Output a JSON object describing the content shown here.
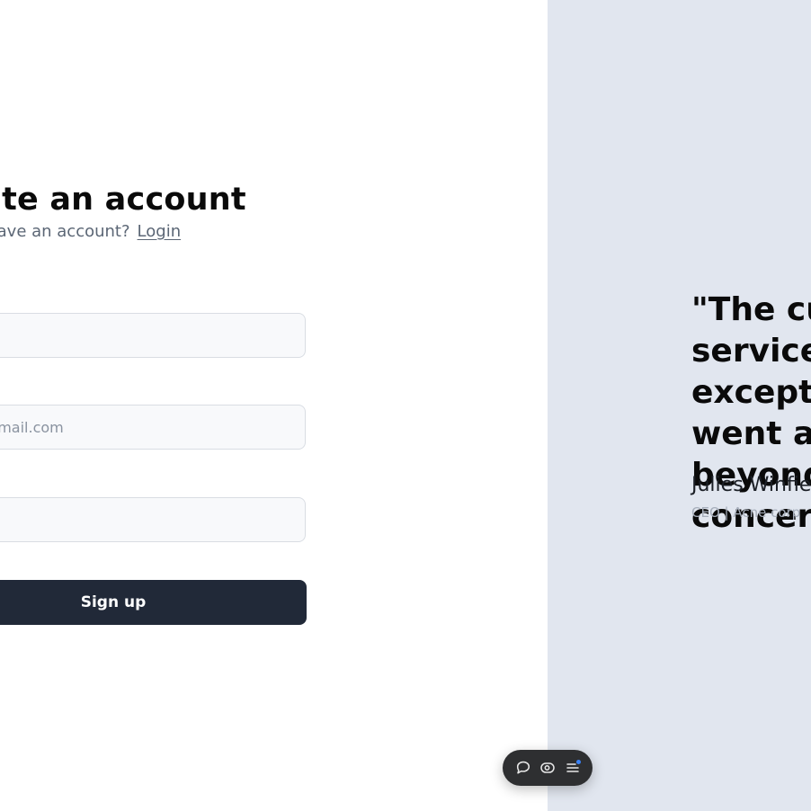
{
  "signup": {
    "title": "Create an account",
    "subtitle": "Already have an account?",
    "login_link": "Login",
    "fields": {
      "name_placeholder": "",
      "email_placeholder": "name@email.com",
      "password_placeholder": ""
    },
    "submit_label": "Sign up"
  },
  "testimonial": {
    "quote": "\"The customer service was exceptional and went above and beyond my concerns.\"",
    "author": "Julies Winfield",
    "role": "CEO | Acne corp"
  },
  "toolbar": {
    "icons": [
      "comment-icon",
      "eye-icon",
      "menu-icon"
    ],
    "indicator_color": "#3b82f6"
  },
  "colors": {
    "panel_background": "#e1e6ef",
    "button_background": "#212938"
  }
}
